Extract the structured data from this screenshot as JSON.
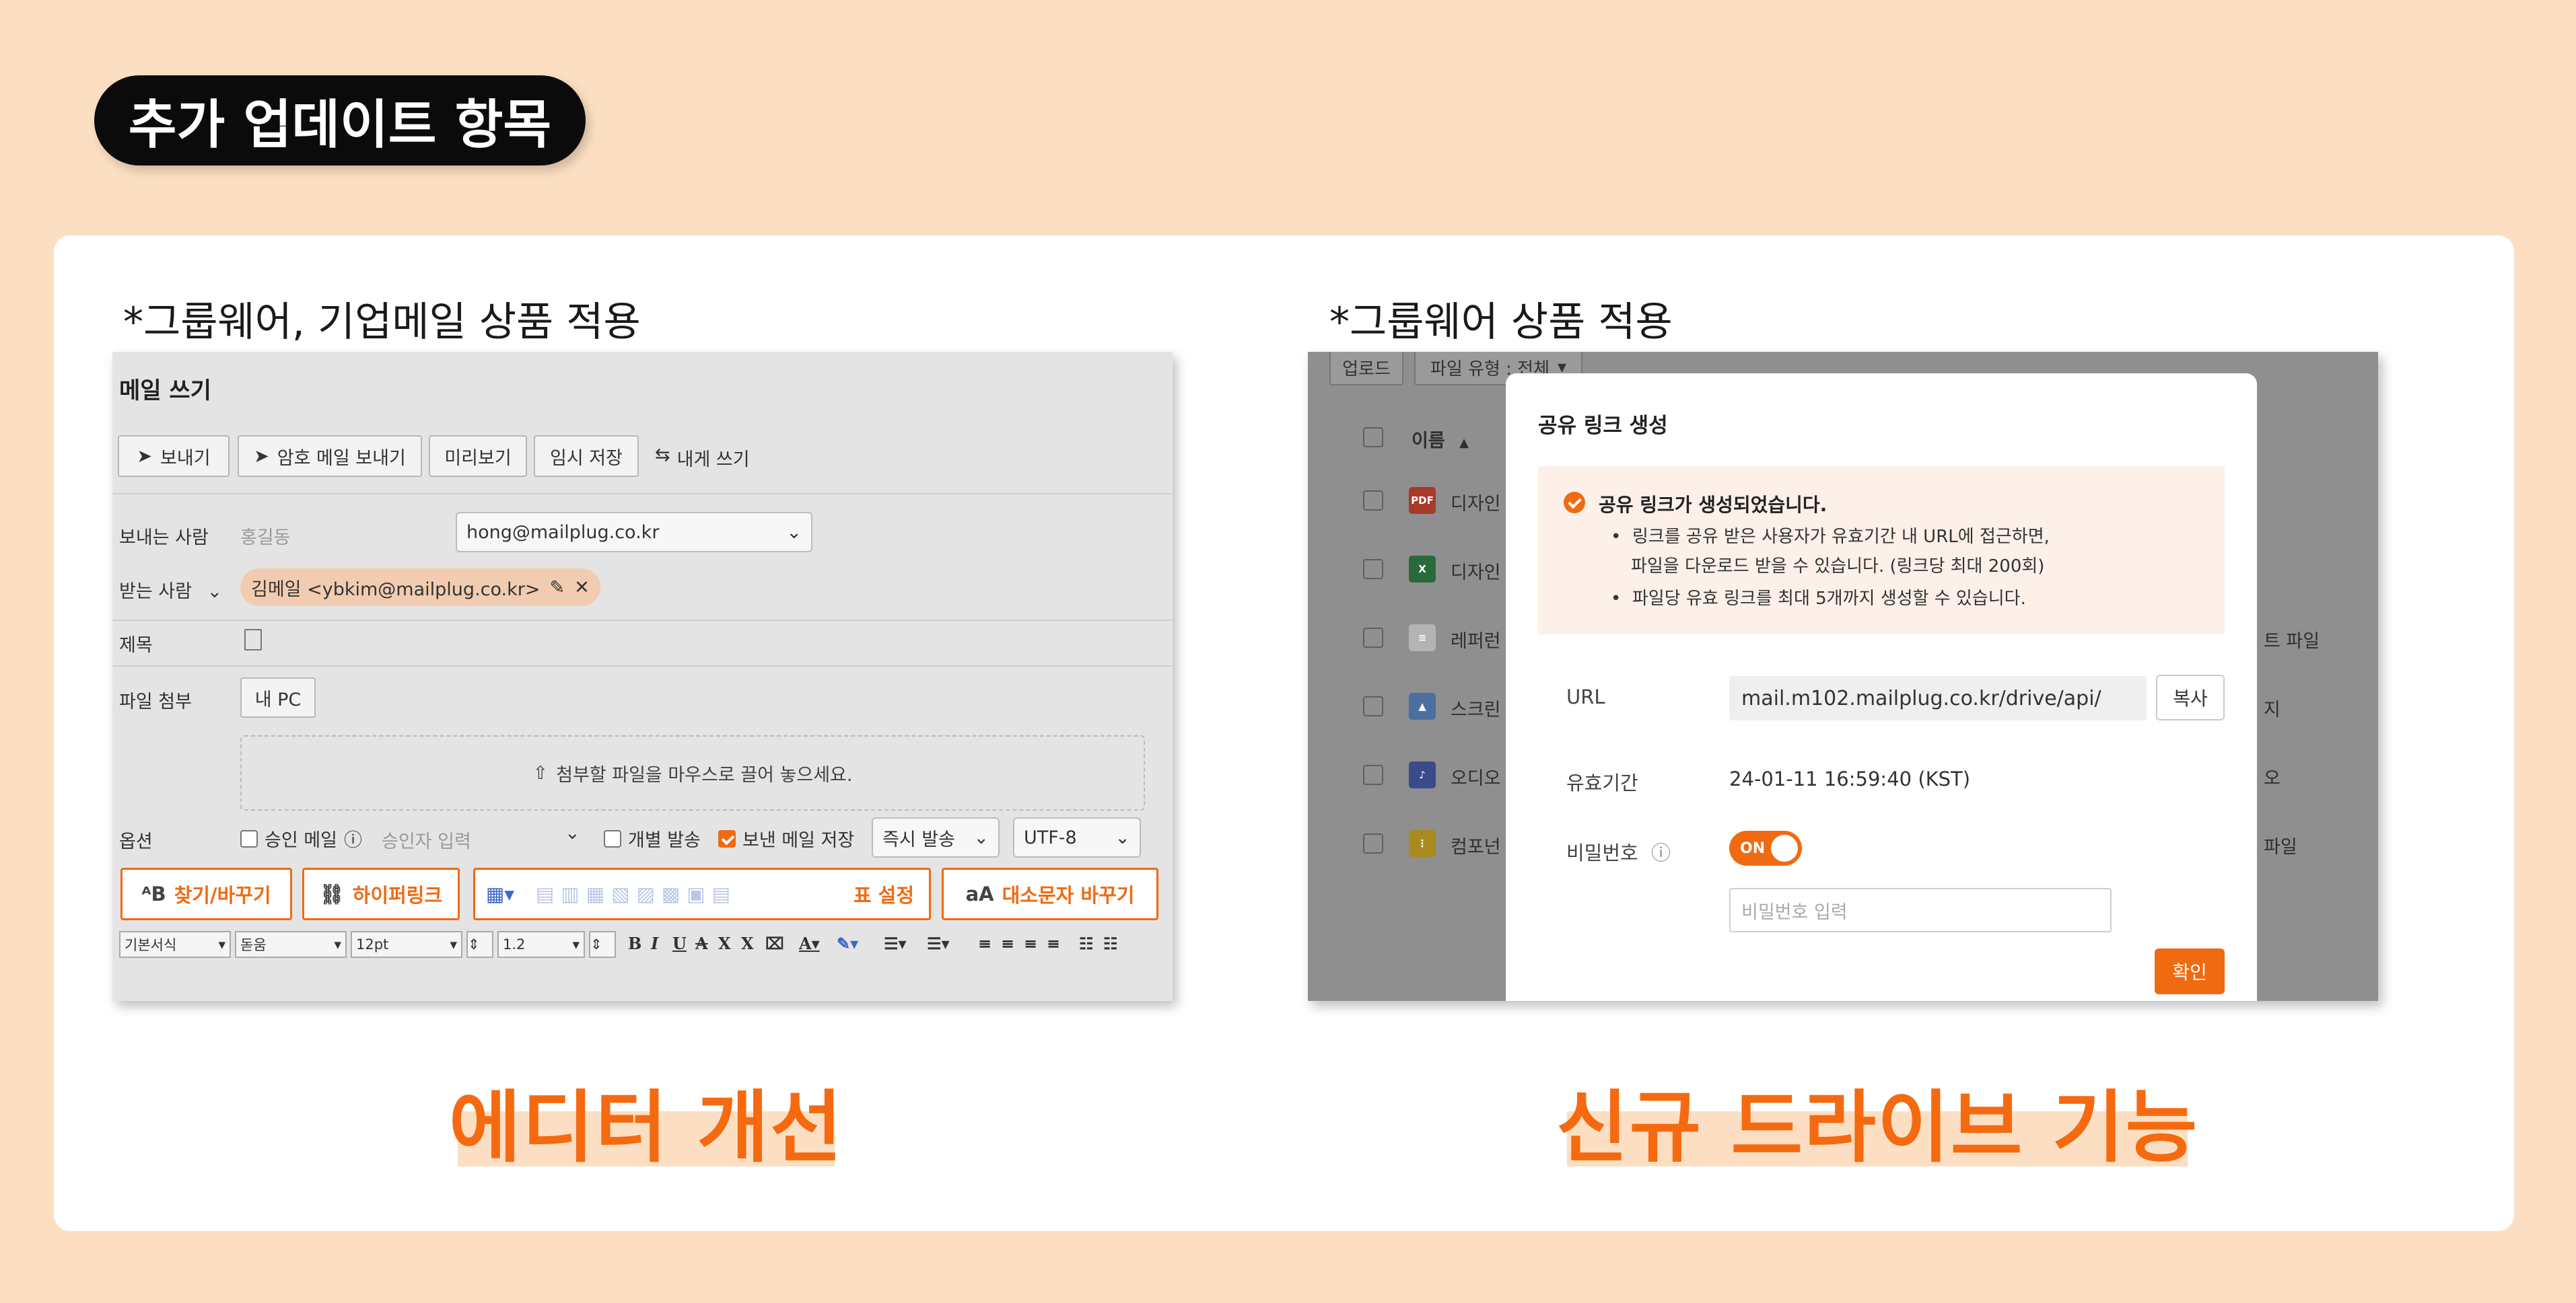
{
  "header": {
    "title": "추가 업데이트 항목"
  },
  "left": {
    "note": "*그룹웨어, 기업메일 상품 적용",
    "caption": "에디터 개선",
    "editor": {
      "title": "메일 쓰기",
      "toolbar": {
        "send": "보내기",
        "encrypted_send": "암호 메일 보내기",
        "preview": "미리보기",
        "draft": "임시 저장",
        "self_write": "내게 쓰기"
      },
      "sender": {
        "label": "보내는 사람",
        "name": "홍길동",
        "email": "hong@mailplug.co.kr"
      },
      "recipient": {
        "label": "받는 사람",
        "chip": "김메일 <ybkim@mailplug.co.kr>"
      },
      "subject": {
        "label": "제목"
      },
      "attach": {
        "label": "파일 첨부",
        "pc_button": "내 PC",
        "drop_hint": "첨부할 파일을 마우스로 끌어 놓으세요."
      },
      "options": {
        "label": "옵션",
        "approval": "승인 메일",
        "approver_placeholder": "승인자 입력",
        "individual": "개별 발송",
        "save_sent": "보낸 메일 저장",
        "send_mode": "즉시 발송",
        "encoding": "UTF-8"
      },
      "feature_buttons": {
        "find_replace": "찾기/바꾸기",
        "hyperlink": "하이퍼링크",
        "table_settings": "표 설정",
        "case_change": "대소문자 바꾸기"
      },
      "format_bar": {
        "style": "기본서식",
        "font": "돋움",
        "size": "12pt",
        "line_height": "1.2",
        "bold": "B",
        "italic": "I",
        "underline": "U",
        "strike": "A",
        "sup": "X",
        "sub": "X"
      }
    }
  },
  "right": {
    "note": "*그룹웨어 상품 적용",
    "caption": "신규 드라이브 기능",
    "drive": {
      "toolbar": {
        "upload": "업로드",
        "file_type": "파일 유형 : 전체"
      },
      "list_header": "이름",
      "rows": [
        {
          "icon": "pdf-icon",
          "name": "디자인",
          "right": ""
        },
        {
          "icon": "excel-icon",
          "name": "디자인",
          "right": ""
        },
        {
          "icon": "doc-icon",
          "name": "레퍼런",
          "right": "트 파일"
        },
        {
          "icon": "image-icon",
          "name": "스크린",
          "right": "지"
        },
        {
          "icon": "audio-icon",
          "name": "오디오",
          "right": "오"
        },
        {
          "icon": "zip-icon",
          "name": "컴포넌",
          "right": "파일"
        }
      ],
      "modal": {
        "title": "공유 링크 생성",
        "success": "공유 링크가 생성되었습니다.",
        "bullet1_line1": "링크를 공유 받은 사용자가 유효기간 내 URL에 접근하면,",
        "bullet1_line2": "파일을 다운로드 받을 수 있습니다. (링크당 최대 200회)",
        "bullet2": "파일당 유효 링크를 최대 5개까지 생성할 수 있습니다.",
        "url_label": "URL",
        "url_value": "mail.m102.mailplug.co.kr/drive/api/",
        "copy": "복사",
        "expiry_label": "유효기간",
        "expiry_value": "24-01-11 16:59:40 (KST)",
        "password_label": "비밀번호",
        "toggle": "ON",
        "password_placeholder": "비밀번호 입력",
        "confirm": "확인"
      }
    }
  },
  "colors": {
    "accent": "#f06a12",
    "background": "#fcdfc2",
    "pill": "#0b0b0b"
  }
}
